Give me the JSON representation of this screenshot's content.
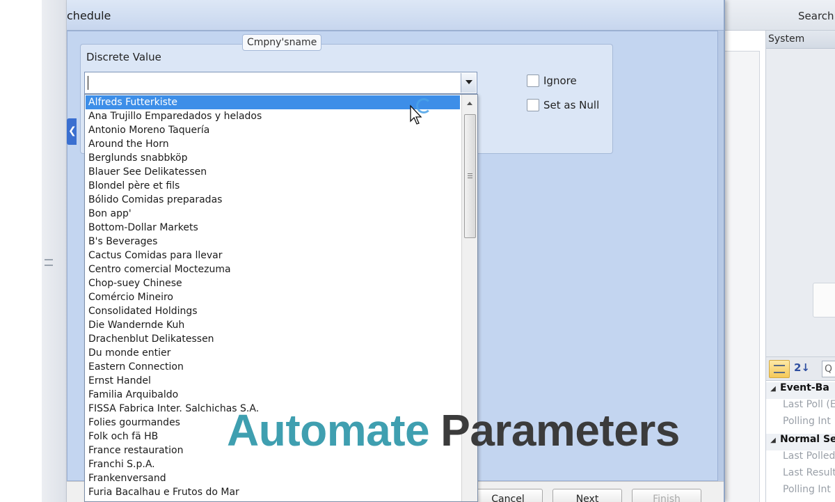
{
  "background": {
    "search_label": "Search",
    "system_panel_title": "System",
    "property_search_placeholder": "Q",
    "property_grid": [
      {
        "kind": "category",
        "label": "Event-Ba"
      },
      {
        "kind": "item",
        "label": "Last Poll (E"
      },
      {
        "kind": "item",
        "label": "Polling Int"
      },
      {
        "kind": "category",
        "label": "Normal Se"
      },
      {
        "kind": "item",
        "label": "Last Polled"
      },
      {
        "kind": "item",
        "label": "Last Result"
      },
      {
        "kind": "item",
        "label": "Polling Int"
      }
    ],
    "icons": [
      "categorized-view-icon",
      "sort-az-icon",
      "left-tab-arrow-icon"
    ]
  },
  "wizard": {
    "title": "chedule",
    "parameter_name": "Cmpny'sname",
    "discrete_value_label": "Discrete Value",
    "discrete_value": "",
    "ignore_label": "Ignore",
    "set_as_null_label": "Set as Null",
    "ignore_checked": false,
    "set_as_null_checked": false,
    "buttons": {
      "cancel": "Cancel",
      "next": "Next",
      "finish": "Finish"
    },
    "options": [
      "Alfreds Futterkiste",
      "Ana Trujillo Emparedados y helados",
      "Antonio Moreno Taquería",
      "Around the Horn",
      "Berglunds snabbköp",
      "Blauer See Delikatessen",
      "Blondel père et fils",
      "Bólido Comidas preparadas",
      "Bon app'",
      "Bottom-Dollar Markets",
      "B's Beverages",
      "Cactus Comidas para llevar",
      "Centro comercial Moctezuma",
      "Chop-suey Chinese",
      "Comércio Mineiro",
      "Consolidated Holdings",
      "Die Wandernde Kuh",
      "Drachenblut Delikatessen",
      "Du monde entier",
      "Eastern Connection",
      "Ernst Handel",
      "Familia Arquibaldo",
      "FISSA Fabrica Inter. Salchichas S.A.",
      "Folies gourmandes",
      "Folk och fä HB",
      "France restauration",
      "Franchi S.p.A.",
      "Frankenversand",
      "Furia Bacalhau e Frutos do Mar"
    ],
    "selected_option": "Alfreds Futterkiste"
  },
  "overlay": {
    "word1": "Automate",
    "word2": "Parameters"
  },
  "colors": {
    "selection": "#3d8ee8",
    "overlay_accent": "#3f9fb0",
    "overlay_dark": "#3b3b3b",
    "wizard_body": "#c3d5f0"
  }
}
